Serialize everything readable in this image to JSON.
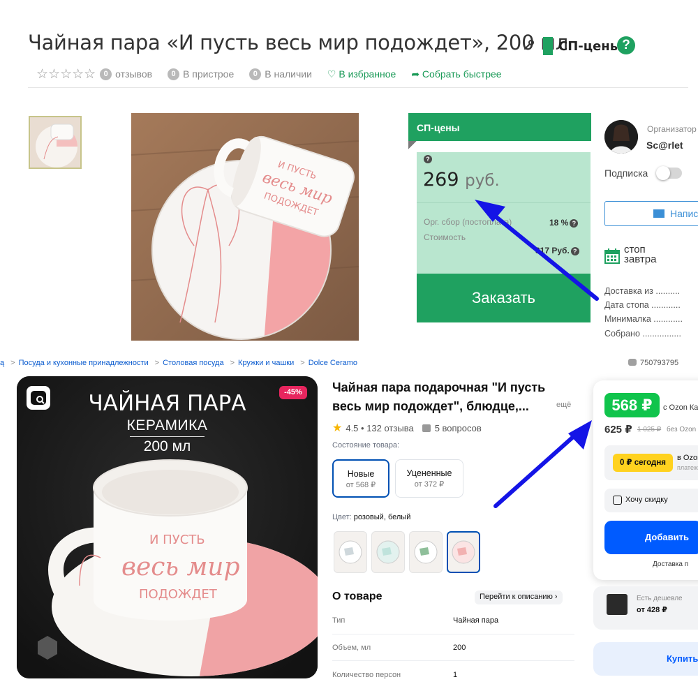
{
  "sp": {
    "title": "Чайная пара «И пусть весь мир подождет», 200 мл",
    "badge_label": "СП-цены",
    "help_label": "?",
    "stars": "☆☆☆☆☆",
    "reviews_count": "0",
    "reviews_label": "отзывов",
    "attach_count": "0",
    "attach_label": "В пристрое",
    "stock_count": "0",
    "stock_label": "В наличии",
    "favorites_label": "♡ В избранное",
    "collect_label": "➦ Собрать быстрее",
    "price_header": "СП-цены",
    "price_q": "?",
    "price_amount": "269",
    "price_currency": "руб.",
    "org_fee_label": "Орг. сбор (постоплата)",
    "org_fee_value": "18 %",
    "cost_label": "Стоимость",
    "cost_value": "317 Руб.",
    "order_button": "Заказать",
    "organizer_title": "Организатор",
    "organizer_name": "Sc@rlet",
    "subscribe_label": "Подписка",
    "write_button": "Написать",
    "stop_line1": "стоп",
    "stop_line2": "завтра",
    "info": [
      "Доставка из ..........",
      "Дата стопа ............",
      "Минималка ............",
      "Собрано ................"
    ],
    "photo_text": [
      "И ПУСТЬ",
      "весь мир",
      "ПОДОЖДЕТ"
    ]
  },
  "ozon": {
    "breadcrumbs": [
      "Посуда и кухонные принадлежности",
      "Столовая посуда",
      "Кружки и чашки",
      "Dolce Ceramo"
    ],
    "crumb_sep": ">",
    "crumb_lead": "ą",
    "article": "750793795",
    "discount_badge": "-45%",
    "promo_title": "ЧАЙНАЯ ПАРА",
    "promo_sub": "КЕРАМИКА",
    "promo_volume": "200 мл",
    "cup_text": [
      "И ПУСТЬ",
      "весь мир",
      "ПОДОЖДЕТ"
    ],
    "product_title": "Чайная пара подарочная \"И пусть весь мир подождет\", блюдце,...",
    "more_label": "ещё",
    "rating": "4.5 • 132 отзыва",
    "questions": "5 вопросов",
    "condition_label": "Состояние товара:",
    "conditions": [
      {
        "name": "Новые",
        "price": "от 568 ₽"
      },
      {
        "name": "Уцененные",
        "price": "от 372 ₽"
      }
    ],
    "color_label": "Цвет:",
    "color_value": "розовый, белый",
    "about_title": "О товаре",
    "desc_link": "Перейти к описанию ›",
    "specs": [
      {
        "k": "Тип",
        "v": "Чайная пара"
      },
      {
        "k": "Объем, мл",
        "v": "200"
      },
      {
        "k": "Количество персон",
        "v": "1"
      }
    ],
    "price_card": "568 ₽",
    "price_card_label": "с Ozon Картой",
    "price_regular": "625 ₽",
    "price_old": "1 025 ₽",
    "price_without": "без Ozon Карты",
    "split_chip": "0 ₽ сегодня",
    "split_v": "в Ozon",
    "split_pl": "платежи",
    "want_discount": "Хочу скидку",
    "add_button": "Добавить",
    "delivery": "Доставка п",
    "cheaper_text": "Есть дешевле",
    "cheaper_price": "от 428 ₽",
    "buy_now": "Купить"
  },
  "colors": {
    "sp_green": "#1fa160",
    "sp_price_bg": "#b9e6cf",
    "ozon_blue": "#005bff",
    "ozon_green_price": "#10c44c",
    "arrow_blue": "#1414e6"
  }
}
